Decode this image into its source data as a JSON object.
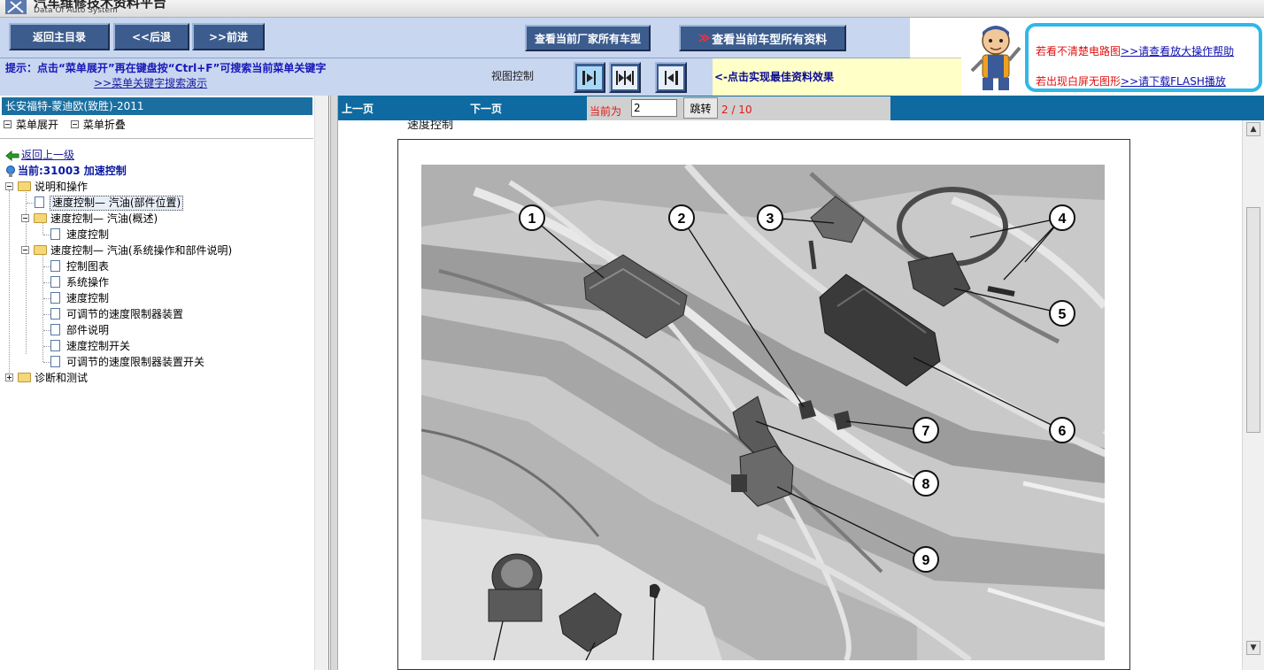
{
  "app": {
    "title": "汽车维修技术资料平台",
    "subtitle": "Data Of Auto System"
  },
  "toolbar": {
    "main_menu_label": "返回主目录",
    "back_label": "<<后退",
    "forward_label": ">>前进",
    "all_models_label": "查看当前厂家所有车型",
    "all_docs_label": "查看当前车型所有资料",
    "all_docs_arrow": "≫"
  },
  "hint": {
    "text": "提示：点击“菜单展开”再在键盘按“Ctrl+F”可搜索当前菜单关键字",
    "link": ">>菜单关键字搜索演示"
  },
  "view_control": {
    "label": "视图控制",
    "tip": "<-点击实现最佳资料效果"
  },
  "help": {
    "line1_text": "若看不清楚电路图",
    "line1_link": ">>请查看放大操作帮助",
    "line2_text": "若出现白屏无图形",
    "line2_link": ">>请下载FLASH播放"
  },
  "sidebar": {
    "car_header": "长安福特-蒙迪欧(致胜)-2011",
    "expand_label": "菜单展开",
    "collapse_label": "菜单折叠",
    "back_up_label": "返回上一级",
    "current_label": "当前:31003 加速控制",
    "tree": {
      "n0": "说明和操作",
      "n1": "速度控制— 汽油(部件位置)",
      "n2": "速度控制— 汽油(概述)",
      "n3": "速度控制",
      "n4": "速度控制— 汽油(系统操作和部件说明)",
      "n5": "控制图表",
      "n6": "系统操作",
      "n7": "速度控制",
      "n8": "可调节的速度限制器装置",
      "n9": "部件说明",
      "n10": "速度控制开关",
      "n11": "可调节的速度限制器装置开关",
      "n12": "诊断和测试"
    }
  },
  "pager": {
    "prev_label": "上一页",
    "next_label": "下一页",
    "current_label": "当前为",
    "current_value": "2",
    "go_label": "跳转",
    "count_text": "2 / 10"
  },
  "content": {
    "section_title": "速度控制",
    "callouts": [
      "1",
      "2",
      "3",
      "4",
      "5",
      "6",
      "7",
      "8",
      "9"
    ]
  },
  "colors": {
    "toolbar_bg": "#c8d6f0",
    "button_bg": "#3c5c8e",
    "pagebar_bg": "#0e6aa0",
    "hint_text": "#1818b8",
    "help_border": "#30b8e8",
    "red_text": "#e01818"
  }
}
